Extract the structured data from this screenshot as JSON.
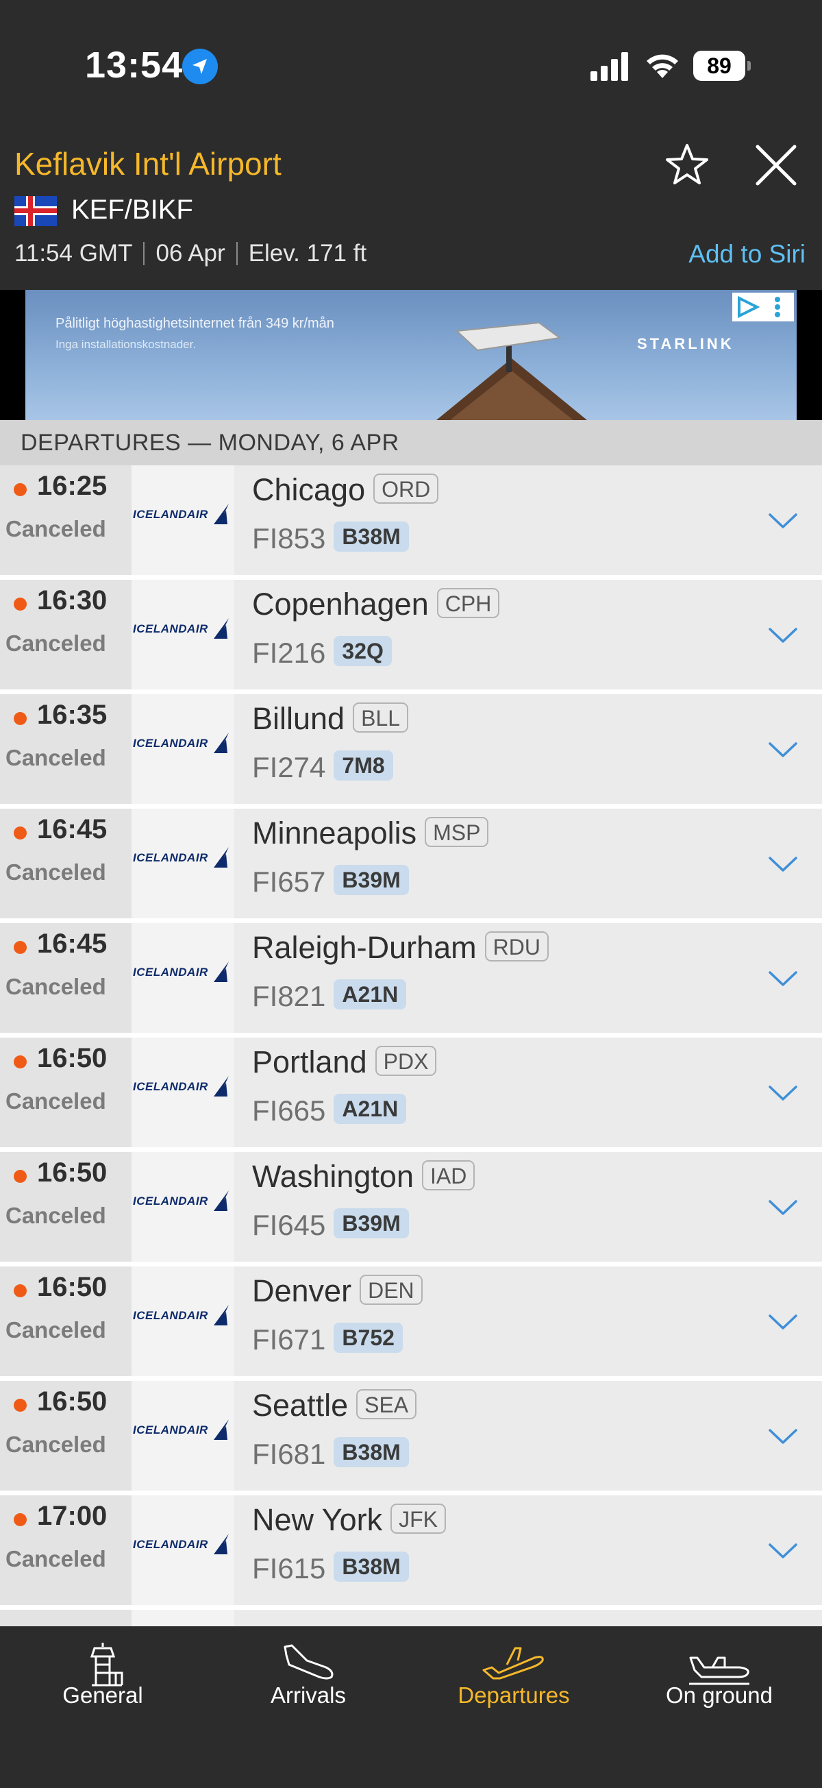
{
  "status_bar": {
    "time": "13:54",
    "battery": "89"
  },
  "header": {
    "airport_name": "Keflavik Int'l Airport",
    "codes": "KEF/BIKF",
    "local_time": "11:54 GMT",
    "date": "06 Apr",
    "elevation": "Elev. 171 ft",
    "siri_label": "Add to Siri"
  },
  "ad": {
    "line1": "Pålitligt höghastighetsinternet från 349 kr/mån",
    "line2": "Inga installationskostnader.",
    "brand": "STARLINK"
  },
  "section_title": "DEPARTURES — MONDAY, 6 APR",
  "airline_logo": "ICELANDAIR",
  "flights": [
    {
      "time": "16:25",
      "status": "Canceled",
      "city": "Chicago",
      "iata": "ORD",
      "flight": "FI853",
      "aircraft": "B38M"
    },
    {
      "time": "16:30",
      "status": "Canceled",
      "city": "Copenhagen",
      "iata": "CPH",
      "flight": "FI216",
      "aircraft": "32Q"
    },
    {
      "time": "16:35",
      "status": "Canceled",
      "city": "Billund",
      "iata": "BLL",
      "flight": "FI274",
      "aircraft": "7M8"
    },
    {
      "time": "16:45",
      "status": "Canceled",
      "city": "Minneapolis",
      "iata": "MSP",
      "flight": "FI657",
      "aircraft": "B39M"
    },
    {
      "time": "16:45",
      "status": "Canceled",
      "city": "Raleigh-Durham",
      "iata": "RDU",
      "flight": "FI821",
      "aircraft": "A21N"
    },
    {
      "time": "16:50",
      "status": "Canceled",
      "city": "Portland",
      "iata": "PDX",
      "flight": "FI665",
      "aircraft": "A21N"
    },
    {
      "time": "16:50",
      "status": "Canceled",
      "city": "Washington",
      "iata": "IAD",
      "flight": "FI645",
      "aircraft": "B39M"
    },
    {
      "time": "16:50",
      "status": "Canceled",
      "city": "Denver",
      "iata": "DEN",
      "flight": "FI671",
      "aircraft": "B752"
    },
    {
      "time": "16:50",
      "status": "Canceled",
      "city": "Seattle",
      "iata": "SEA",
      "flight": "FI681",
      "aircraft": "B38M"
    },
    {
      "time": "17:00",
      "status": "Canceled",
      "city": "New York",
      "iata": "JFK",
      "flight": "FI615",
      "aircraft": "B38M"
    }
  ],
  "tabs": [
    {
      "label": "General",
      "icon": "control-tower-icon"
    },
    {
      "label": "Arrivals",
      "icon": "plane-landing-icon"
    },
    {
      "label": "Departures",
      "icon": "plane-takeoff-icon",
      "active": true
    },
    {
      "label": "On ground",
      "icon": "plane-on-ground-icon"
    }
  ],
  "colors": {
    "accent": "#f6b82a",
    "link": "#5fc0f4",
    "canceled_dot": "#ef5b16",
    "chevron": "#3f8fd8"
  }
}
